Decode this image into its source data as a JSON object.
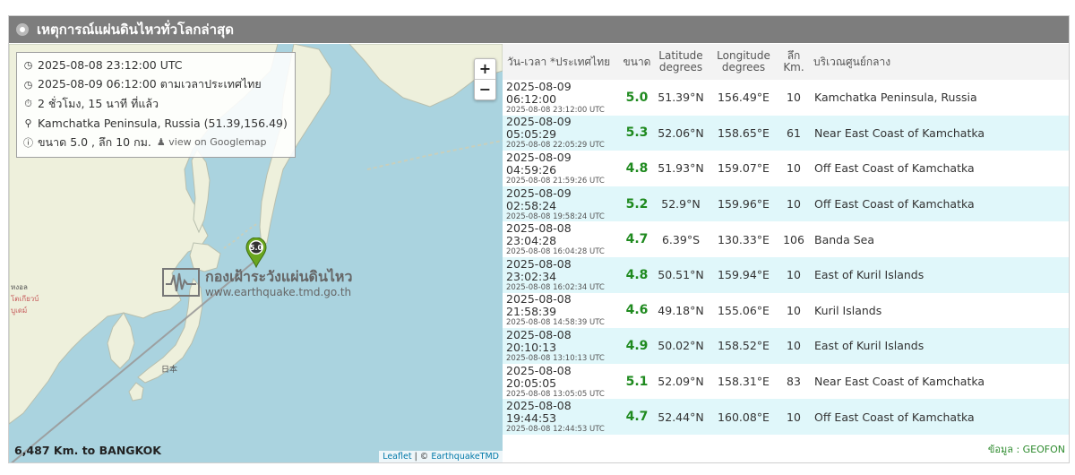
{
  "header": {
    "title": "เหตุการณ์แผ่นดินไหวทั่วโลกล่าสุด"
  },
  "info": {
    "utc": "2025-08-08 23:12:00 UTC",
    "local": "2025-08-09 06:12:00 ตามเวลาประเทศไทย",
    "ago": "2 ชั่วโมง, 15 นาที ที่แล้ว",
    "place": "Kamchatka Peninsula, Russia (51.39,156.49)",
    "magdepth": "ขนาด 5.0 , ลึก 10 กม.",
    "gmap": "view on Googlemap"
  },
  "map": {
    "zoom_in": "+",
    "zoom_out": "−",
    "marker_label": "5.0",
    "watermark_name": "กองเฝ้าระวังแผ่นดินไหว",
    "watermark_url": "www.earthquake.tmd.go.th",
    "distance": "6,487 Km. to BANGKOK",
    "attribution_leaflet": "Leaflet",
    "attribution_sep": " | © ",
    "attribution_owner": "EarthquakeTMD",
    "place_japan": "日本",
    "place_cn1": "หงอล",
    "place_cn2": "โตเกียวบ์",
    "place_cn3": "บูเดม์"
  },
  "table": {
    "headers": {
      "datetime": "วัน-เวลา *ประเทศไทย",
      "mag": "ขนาด",
      "lat1": "Latitude",
      "lat2": "degrees",
      "lon1": "Longitude",
      "lon2": "degrees",
      "depth1": "ลึก",
      "depth2": "Km.",
      "region": "บริเวณศูนย์กลาง"
    },
    "rows": [
      {
        "local": "2025-08-09 06:12:00",
        "utc": "2025-08-08 23:12:00 UTC",
        "mag": "5.0",
        "lat": "51.39°N",
        "lon": "156.49°E",
        "depth": "10",
        "region": "Kamchatka Peninsula, Russia"
      },
      {
        "local": "2025-08-09 05:05:29",
        "utc": "2025-08-08 22:05:29 UTC",
        "mag": "5.3",
        "lat": "52.06°N",
        "lon": "158.65°E",
        "depth": "61",
        "region": "Near East Coast of Kamchatka"
      },
      {
        "local": "2025-08-09 04:59:26",
        "utc": "2025-08-08 21:59:26 UTC",
        "mag": "4.8",
        "lat": "51.93°N",
        "lon": "159.07°E",
        "depth": "10",
        "region": "Off East Coast of Kamchatka"
      },
      {
        "local": "2025-08-09 02:58:24",
        "utc": "2025-08-08 19:58:24 UTC",
        "mag": "5.2",
        "lat": "52.9°N",
        "lon": "159.96°E",
        "depth": "10",
        "region": "Off East Coast of Kamchatka"
      },
      {
        "local": "2025-08-08 23:04:28",
        "utc": "2025-08-08 16:04:28 UTC",
        "mag": "4.7",
        "lat": "6.39°S",
        "lon": "130.33°E",
        "depth": "106",
        "region": "Banda Sea"
      },
      {
        "local": "2025-08-08 23:02:34",
        "utc": "2025-08-08 16:02:34 UTC",
        "mag": "4.8",
        "lat": "50.51°N",
        "lon": "159.94°E",
        "depth": "10",
        "region": "East of Kuril Islands"
      },
      {
        "local": "2025-08-08 21:58:39",
        "utc": "2025-08-08 14:58:39 UTC",
        "mag": "4.6",
        "lat": "49.18°N",
        "lon": "155.06°E",
        "depth": "10",
        "region": "Kuril Islands"
      },
      {
        "local": "2025-08-08 20:10:13",
        "utc": "2025-08-08 13:10:13 UTC",
        "mag": "4.9",
        "lat": "50.02°N",
        "lon": "158.52°E",
        "depth": "10",
        "region": "East of Kuril Islands"
      },
      {
        "local": "2025-08-08 20:05:05",
        "utc": "2025-08-08 13:05:05 UTC",
        "mag": "5.1",
        "lat": "52.09°N",
        "lon": "158.31°E",
        "depth": "83",
        "region": "Near East Coast of Kamchatka"
      },
      {
        "local": "2025-08-08 19:44:53",
        "utc": "2025-08-08 12:44:53 UTC",
        "mag": "4.7",
        "lat": "52.44°N",
        "lon": "160.08°E",
        "depth": "10",
        "region": "Off East Coast of Kamchatka"
      }
    ]
  },
  "source": "ข้อมูล : GEOFON",
  "colors": {
    "header_bg": "#7d7d7d",
    "sea": "#aad3df",
    "land": "#eef0dc",
    "row_alt": "#e0f7fa",
    "magnitude": "#1f8a1f",
    "marker": "#6aa61f"
  },
  "icons": [
    "circle-icon",
    "clock-icon",
    "stopwatch-icon",
    "map-pin-icon",
    "info-icon",
    "street-view-icon",
    "seismograph-icon"
  ]
}
